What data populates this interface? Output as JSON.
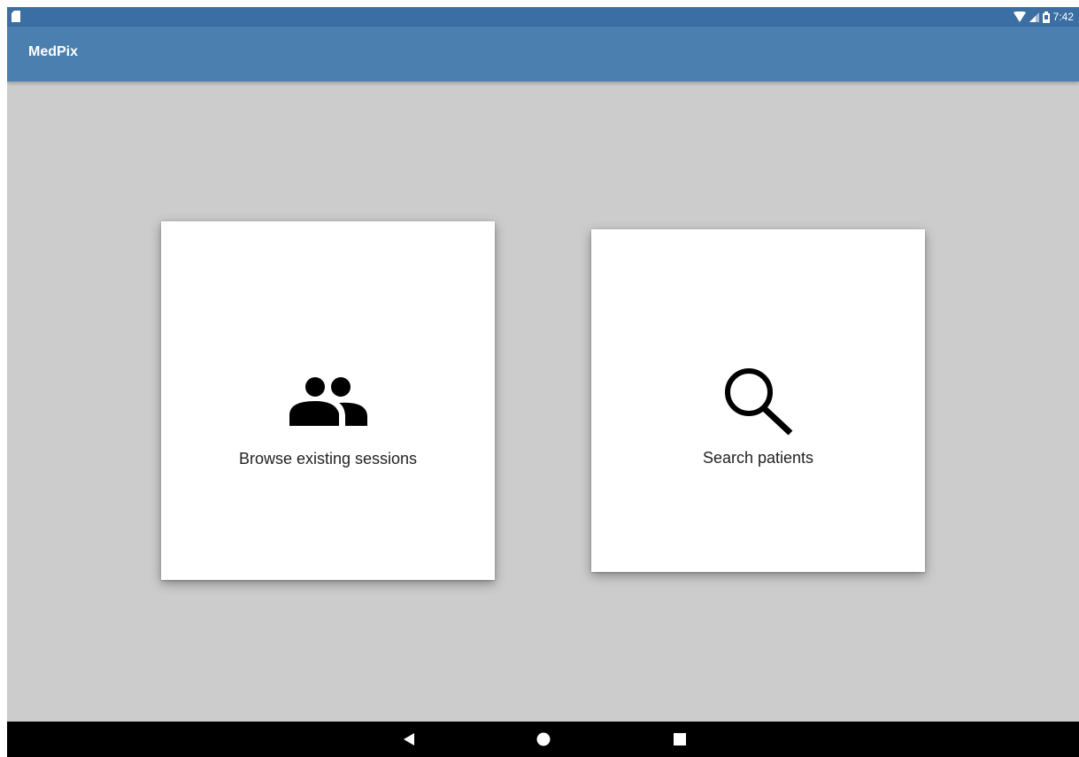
{
  "status_bar": {
    "time": "7:42",
    "icons": [
      "sd-card-icon",
      "wifi-icon",
      "cell-signal-icon",
      "battery-icon"
    ]
  },
  "app_bar": {
    "title": "MedPix"
  },
  "cards": [
    {
      "label": "Browse existing sessions",
      "icon": "people-icon"
    },
    {
      "label": "Search patients",
      "icon": "search-icon"
    }
  ],
  "nav_bar": {
    "buttons": [
      "back",
      "home",
      "recents"
    ]
  },
  "colors": {
    "status_bar": "#3b6ea3",
    "app_bar": "#4a7fb0",
    "background": "#cccccc",
    "card": "#ffffff",
    "nav_bar": "#000000"
  }
}
